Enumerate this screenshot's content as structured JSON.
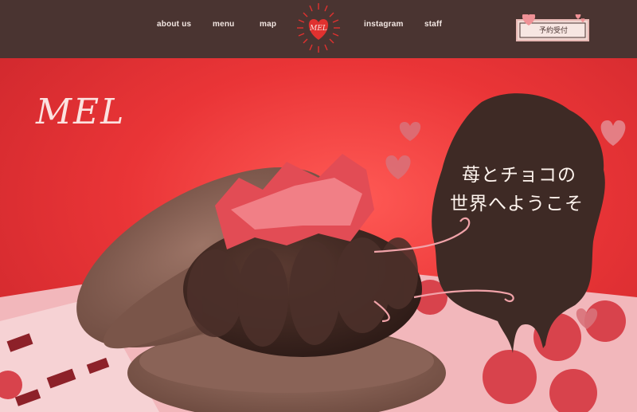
{
  "header": {
    "nav": [
      {
        "label": "about us"
      },
      {
        "label": "menu"
      },
      {
        "label": "map"
      },
      {
        "label": "instagram"
      },
      {
        "label": "staff"
      }
    ],
    "logo_text": "MEL",
    "reserve_label": "予約受付"
  },
  "hero": {
    "brand": "MEL",
    "headline_line1": "苺とチョコの",
    "headline_line2": "世界へようこそ"
  },
  "colors": {
    "header_bg": "#4a3431",
    "hero_red": "#e93a3c",
    "chocolate": "#3e2a25",
    "macaron": "#8a6357",
    "pink": "#f4b6b8"
  }
}
